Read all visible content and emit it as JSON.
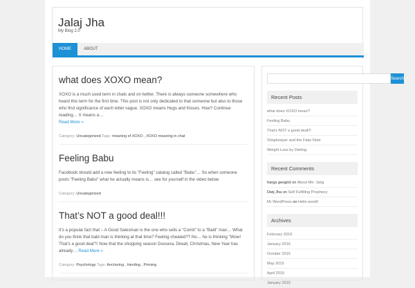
{
  "site": {
    "title": "Jalaj Jha",
    "tagline": "My Blog 2.0"
  },
  "nav": [
    "HOME",
    "ABOUT"
  ],
  "posts": [
    {
      "title": "what does XOXO mean?",
      "excerpt": "XOXO is a much used term in chats and on twitter. There is always someone somewhere who heard this term for the first time. This post is not only dedicated to that someone but also to those who find significance of each letter vague. XOXO means Hugs and Kisses. How? Continue reading… X means a…",
      "more": "Read More »",
      "category_label": "Category:",
      "category": "Uncategorized",
      "tags_label": "Tags:",
      "tags": "meaning of XOXO , XOXO meaning in chat"
    },
    {
      "title": "Feeling Babu",
      "excerpt": "Facebook should add a new feeling to its \"Feeling\" catalog called \"Babu\"… So when someone posts \"Feeling Babu\" what he actually means is… see for yourself in the video below",
      "category_label": "Category:",
      "category": "Uncategorized"
    },
    {
      "title": "That’s NOT a good deal!!!",
      "excerpt": "It’s a popular fact that – A Good Salesman is the one who sells a \"Comb\" to a \"Bald\" man… What do you think that bald man is thinking at that time? Feeling cheated?? No… he is thinking \"Wow! That’s a good deal\"!! Now that the shopping season Dussera, Diwali, Christmas, New Year has already…",
      "more": "Read More »",
      "category_label": "Category:",
      "category": "Psychology",
      "tags_label": "Tags:",
      "tags": "Anchoring , Herding , Priming"
    }
  ],
  "sidebar": {
    "search_button": "Search",
    "recent_posts_title": "Recent Posts",
    "recent_posts": [
      "what does XOXO mean?",
      "Feeling Babu",
      "That’s NOT a good deal!!!",
      "Shopkeeper and the Fake Note",
      "Weight Loss by Dieting"
    ],
    "recent_comments_title": "Recent Comments",
    "recent_comments": [
      {
        "who": "harga geogrid",
        "on": "on",
        "post": "About Me: Jalaj"
      },
      {
        "who": "Dwij Jha",
        "on": "on",
        "post": "Self Fulfilling Prophecy"
      },
      {
        "who": "Mr WordPress",
        "on": "on",
        "post": "Hello world!"
      }
    ],
    "archives_title": "Archives",
    "archives": [
      "February 2016",
      "January 2016",
      "October 2015",
      "May 2015",
      "April 2015",
      "January 2015"
    ]
  }
}
